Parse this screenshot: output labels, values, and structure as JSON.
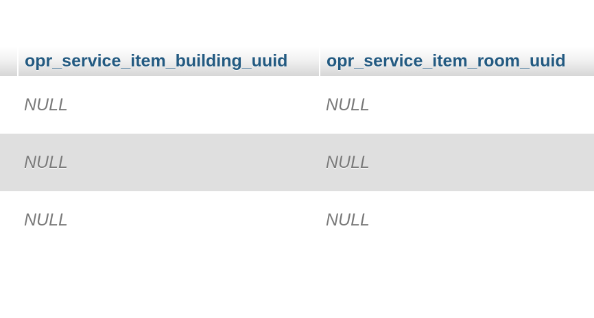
{
  "table": {
    "columns": [
      {
        "name": "opr_service_item_building_uuid"
      },
      {
        "name": "opr_service_item_room_uuid"
      }
    ],
    "rows": [
      {
        "cells": [
          "NULL",
          "NULL"
        ]
      },
      {
        "cells": [
          "NULL",
          "NULL"
        ]
      },
      {
        "cells": [
          "NULL",
          "NULL"
        ]
      }
    ]
  }
}
